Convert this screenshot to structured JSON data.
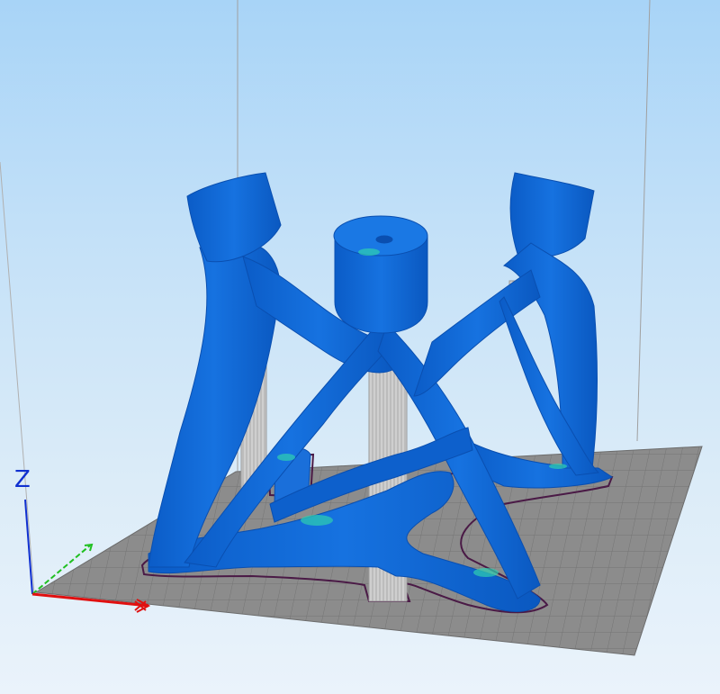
{
  "viewport": {
    "axis_labels": {
      "z": "Z"
    },
    "colors": {
      "background_top": "#a8d4f7",
      "background_bottom": "#eaf3fb",
      "bed": "#8c8c8c",
      "bed_grid": "#6f6f6f",
      "model": "#0f66d6",
      "model_highlight": "#3b8ff0",
      "model_overhang": "#2fd0b0",
      "support": "#c9c9c9",
      "skirt": "#4a1a46",
      "axis_x": "#e01010",
      "axis_y": "#20c020",
      "axis_z": "#1030d0",
      "build_volume_edge": "#9a9a9a"
    },
    "icons": [
      "x-axis-arrow-icon",
      "y-axis-arrow-icon",
      "z-axis-arrow-icon"
    ]
  }
}
